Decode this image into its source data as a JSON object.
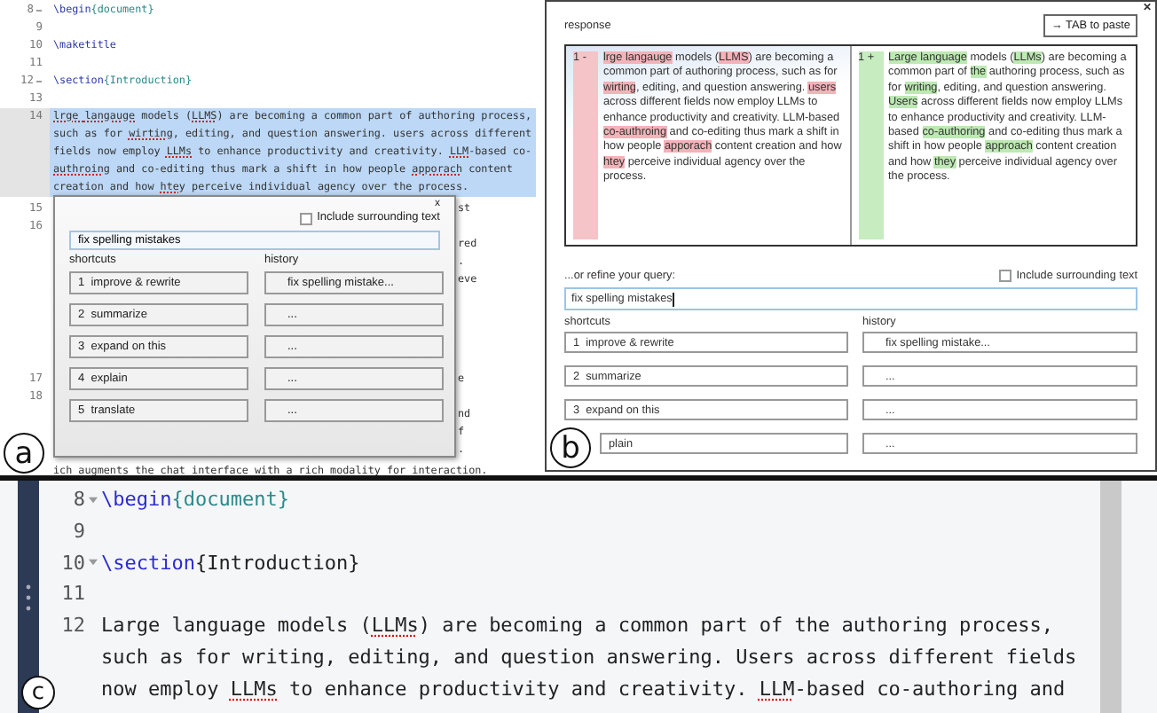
{
  "panel_a": {
    "label": "a",
    "code_lines": [
      {
        "number": "8",
        "fold": true,
        "selected": false,
        "segments": [
          {
            "kind": "command",
            "text": "\\begin"
          },
          {
            "kind": "argument",
            "text": "{document}"
          }
        ]
      },
      {
        "number": "9",
        "fold": false,
        "selected": false
      },
      {
        "number": "10",
        "fold": false,
        "selected": false,
        "segments": [
          {
            "kind": "command",
            "text": "\\maketitle"
          }
        ]
      },
      {
        "number": "11",
        "fold": false,
        "selected": false
      },
      {
        "number": "12",
        "fold": true,
        "selected": false,
        "segments": [
          {
            "kind": "command",
            "text": "\\section"
          },
          {
            "kind": "argument",
            "text": "{Introduction}"
          }
        ]
      },
      {
        "number": "13",
        "fold": false,
        "selected": false
      },
      {
        "number": "14",
        "fold": false,
        "selected": true,
        "segments": [
          {
            "kind": "misspelled",
            "text": "lrge "
          },
          {
            "kind": "misspelled",
            "text": "langauge"
          },
          {
            "kind": "plain",
            "text": " models ("
          },
          {
            "kind": "misspelled",
            "text": "LLMS"
          },
          {
            "kind": "plain",
            "text": ") are becoming a common part of authoring process, such as for "
          },
          {
            "kind": "misspelled",
            "text": "wirting"
          },
          {
            "kind": "plain",
            "text": ", editing, and question answering. users across different fields now employ "
          },
          {
            "kind": "misspelled",
            "text": "LLMs"
          },
          {
            "kind": "plain",
            "text": " to enhance productivity and creativity. "
          },
          {
            "kind": "misspelled",
            "text": "LLM"
          },
          {
            "kind": "plain",
            "text": "-based co-"
          },
          {
            "kind": "misspelled",
            "text": "authroing"
          },
          {
            "kind": "plain",
            "text": " and co-editing thus mark a shift in how people "
          },
          {
            "kind": "misspelled",
            "text": "apporach"
          },
          {
            "kind": "plain",
            "text": " content creation and how "
          },
          {
            "kind": "misspelled",
            "text": "htey"
          },
          {
            "kind": "plain",
            "text": " perceive individual agency over the process."
          }
        ]
      }
    ],
    "covered_lines": [
      [
        {
          "number": "15",
          "fragment": "st"
        },
        {
          "number": "16"
        },
        {
          "fragment": "red"
        },
        {
          "fragment": "."
        },
        {
          "fragment": "eve"
        }
      ],
      [
        {
          "number": "17",
          "fragment": "e"
        },
        {
          "number": "18"
        },
        {
          "fragment": "nd"
        },
        {
          "fragment": "f"
        },
        {
          "fragment": "."
        }
      ]
    ],
    "last_line": "ich augments the chat interface with a rich modality for interaction.",
    "popup": {
      "close": "x",
      "include_surrounding": {
        "label": "Include surrounding text",
        "checked": false
      },
      "query": "fix spelling mistakes",
      "shortcuts_title": "shortcuts",
      "history_title": "history",
      "shortcuts": [
        {
          "number": "1",
          "label": "improve & rewrite"
        },
        {
          "number": "2",
          "label": "summarize"
        },
        {
          "number": "3",
          "label": "expand on this"
        },
        {
          "number": "4",
          "label": "explain"
        },
        {
          "number": "5",
          "label": "translate"
        }
      ],
      "history": [
        "fix spelling mistake...",
        "...",
        "...",
        "...",
        "..."
      ]
    }
  },
  "panel_b": {
    "label": "b",
    "close": "✕",
    "title": "response",
    "paste_button": "→ TAB to paste",
    "diff": [
      {
        "kind": "removed",
        "marker": "1 -",
        "segments": [
          {
            "kind": "changed",
            "text": "lrge "
          },
          {
            "kind": "changed",
            "text": "langauge"
          },
          {
            "kind": "plain",
            "text": " models ("
          },
          {
            "kind": "changed",
            "text": "LLMS"
          },
          {
            "kind": "plain",
            "text": ") are becoming a common part of authoring process, such as for "
          },
          {
            "kind": "changed",
            "text": "wirting"
          },
          {
            "kind": "plain",
            "text": ", editing, and question answering. "
          },
          {
            "kind": "changed",
            "text": "users"
          },
          {
            "kind": "plain",
            "text": " across different fields now employ LLMs to enhance productivity and creativity. LLM-based "
          },
          {
            "kind": "changed",
            "text": "co-authroing"
          },
          {
            "kind": "plain",
            "text": " and co-editing thus mark a shift in how people "
          },
          {
            "kind": "changed",
            "text": "apporach"
          },
          {
            "kind": "plain",
            "text": " content creation and how "
          },
          {
            "kind": "changed",
            "text": "htey"
          },
          {
            "kind": "plain",
            "text": " perceive individual agency over the process."
          }
        ]
      },
      {
        "kind": "added",
        "marker": "1 +",
        "segments": [
          {
            "kind": "changed",
            "text": "Large "
          },
          {
            "kind": "changed",
            "text": "language"
          },
          {
            "kind": "plain",
            "text": " models ("
          },
          {
            "kind": "changed",
            "text": "LLMs"
          },
          {
            "kind": "plain",
            "text": ") are becoming a common part of "
          },
          {
            "kind": "changed",
            "text": "the"
          },
          {
            "kind": "plain",
            "text": " authoring process, such as for "
          },
          {
            "kind": "changed",
            "text": "writing"
          },
          {
            "kind": "plain",
            "text": ", editing, and question answering. "
          },
          {
            "kind": "changed",
            "text": "Users"
          },
          {
            "kind": "plain",
            "text": " across different fields now employ LLMs to enhance productivity and creativity. LLM-based "
          },
          {
            "kind": "changed",
            "text": "co-authoring"
          },
          {
            "kind": "plain",
            "text": " and co-editing thus mark a shift in how people "
          },
          {
            "kind": "changed",
            "text": "approach"
          },
          {
            "kind": "plain",
            "text": " content creation and how "
          },
          {
            "kind": "changed",
            "text": "they"
          },
          {
            "kind": "plain",
            "text": " perceive individual agency over the process."
          }
        ]
      }
    ],
    "refine_label": "...or refine your query:",
    "include_surrounding": {
      "label": "Include surrounding text",
      "checked": false
    },
    "query": "fix spelling mistakes",
    "shortcuts_title": "shortcuts",
    "history_title": "history",
    "shortcuts": [
      {
        "number": "1",
        "label": "improve & rewrite"
      },
      {
        "number": "2",
        "label": "summarize"
      },
      {
        "number": "3",
        "label": "expand on this"
      },
      {
        "label": "plain"
      }
    ],
    "history": [
      "fix spelling mistake...",
      "...",
      "...",
      "..."
    ]
  },
  "panel_c": {
    "label": "c",
    "code_lines": [
      {
        "number": "8",
        "fold": true,
        "segments": [
          {
            "kind": "command",
            "text": "\\begin"
          },
          {
            "kind": "argument",
            "text": "{document}"
          }
        ]
      },
      {
        "number": "9",
        "fold": false
      },
      {
        "number": "10",
        "fold": true,
        "segments": [
          {
            "kind": "command",
            "text": "\\section"
          },
          {
            "kind": "plain",
            "text": "{Introduction}"
          }
        ]
      },
      {
        "number": "11",
        "fold": false
      },
      {
        "number": "12",
        "fold": false,
        "segments": [
          {
            "kind": "plain",
            "text": "Large language models ("
          },
          {
            "kind": "misspelled",
            "text": "LLMs"
          },
          {
            "kind": "plain",
            "text": ") are becoming a common part of the authoring process, such as for writing, editing, and question answering. Users across different fields now employ "
          },
          {
            "kind": "misspelled",
            "text": "LLMs"
          },
          {
            "kind": "plain",
            "text": " to enhance productivity and creativity. "
          },
          {
            "kind": "misspelled",
            "text": "LLM"
          },
          {
            "kind": "plain",
            "text": "-based co-authoring and"
          }
        ]
      }
    ]
  }
}
